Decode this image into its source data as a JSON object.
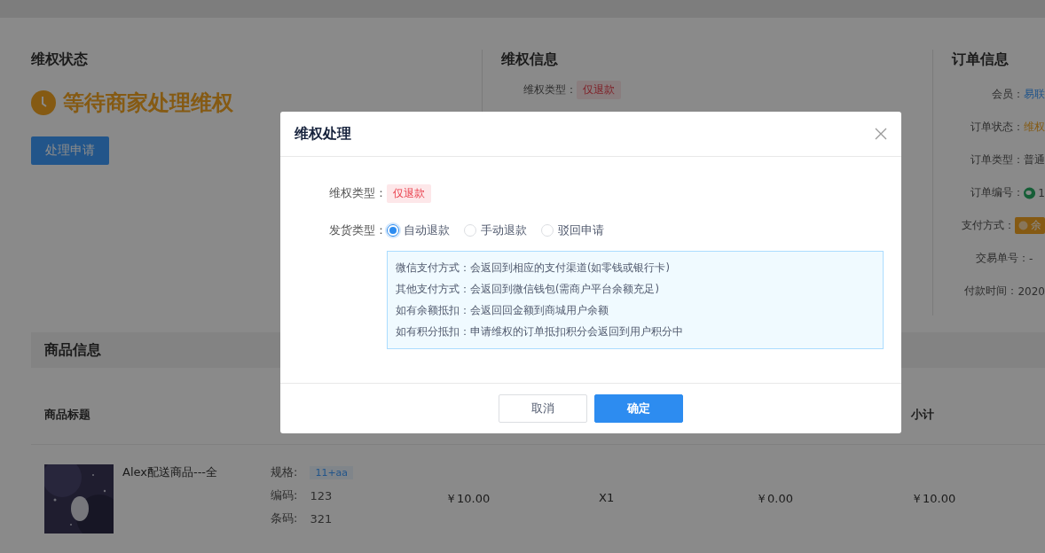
{
  "status": {
    "heading": "维权状态",
    "state": "等待商家处理维权",
    "action": "处理申请"
  },
  "rights_info": {
    "heading": "维权信息",
    "fields": [
      {
        "label": "维权类型：",
        "value": "仅退款",
        "kind": "tag"
      }
    ]
  },
  "order_info": {
    "heading": "订单信息",
    "fields": [
      {
        "label": "会员：",
        "value": "易联",
        "kind": "link"
      },
      {
        "label": "订单状态：",
        "value": "维权",
        "kind": "warn"
      },
      {
        "label": "订单类型：",
        "value": "普通",
        "kind": "text"
      },
      {
        "label": "订单编号：",
        "value": "1",
        "kind": "wechat"
      },
      {
        "label": "支付方式：",
        "value": "余",
        "kind": "pay"
      },
      {
        "label": "交易单号：",
        "value": "-",
        "kind": "text"
      },
      {
        "label": "付款时间：",
        "value": "2020",
        "kind": "text"
      }
    ]
  },
  "goods": {
    "heading": "商品信息",
    "header": {
      "title": "商品标题",
      "subtotal": "小计"
    },
    "rows": [
      {
        "title": "Alex配送商品---全",
        "spec_label": "规格:",
        "spec": "11+aa",
        "code_label": "编码:",
        "code": "123",
        "barcode_label": "条码:",
        "barcode": "321",
        "price": "￥10.00",
        "qty": "X1",
        "discount": "￥0.00",
        "subtotal": "￥10.00"
      }
    ]
  },
  "dialog": {
    "title": "维权处理",
    "type_label": "维权类型：",
    "type_value": "仅退款",
    "ship_label": "发货类型：",
    "options": [
      {
        "label": "自动退款",
        "selected": true
      },
      {
        "label": "手动退款",
        "selected": false
      },
      {
        "label": "驳回申请",
        "selected": false
      }
    ],
    "notes": [
      "微信支付方式：会返回到相应的支付渠道(如零钱或银行卡)",
      "其他支付方式：会返回到微信钱包(需商户平台余额充足)",
      "如有余额抵扣：会返回回金额到商城用户余额",
      "如有积分抵扣：申请维权的订单抵扣积分会返回到用户积分中"
    ],
    "cancel": "取消",
    "confirm": "确定"
  }
}
